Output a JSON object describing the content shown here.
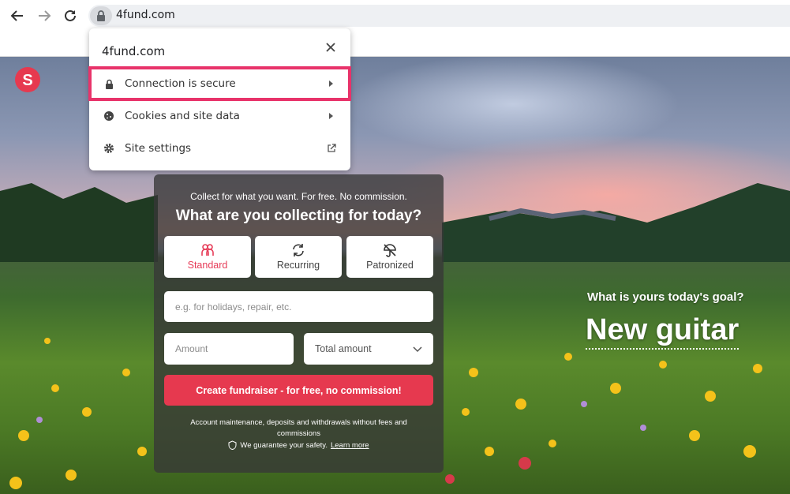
{
  "browser": {
    "url": "4fund.com",
    "icons": {
      "back": "back-arrow-icon",
      "forward": "forward-arrow-icon",
      "reload": "reload-icon",
      "lock": "lock-icon"
    }
  },
  "site_info_popup": {
    "title": "4fund.com",
    "rows": [
      {
        "label": "Connection is secure",
        "icon": "lock-icon",
        "trailing": "arrow-right-icon",
        "highlighted": true
      },
      {
        "label": "Cookies and site data",
        "icon": "cookie-icon",
        "trailing": "arrow-right-icon"
      },
      {
        "label": "Site settings",
        "icon": "gear-icon",
        "trailing": "external-link-icon"
      }
    ]
  },
  "form": {
    "subtitle": "Collect for what you want. For free. No commission.",
    "title": "What are you collecting for today?",
    "types": [
      {
        "label": "Standard",
        "icon": "people-icon",
        "active": true
      },
      {
        "label": "Recurring",
        "icon": "recurring-icon",
        "active": false
      },
      {
        "label": "Patronized",
        "icon": "umbrella-icon",
        "active": false
      }
    ],
    "purpose_placeholder": "e.g. for holidays, repair, etc.",
    "amount_placeholder": "Amount",
    "amount_type_selected": "Total amount",
    "cta_label": "Create fundraiser - for free, no commission!",
    "fine_print": "Account maintenance, deposits and withdrawals without fees and commissions",
    "safety_text": "We guarantee your safety.",
    "learn_more": "Learn more"
  },
  "hero": {
    "question": "What is yours today's goal?",
    "goal": "New guitar"
  },
  "colors": {
    "accent": "#e6394f",
    "highlight": "#e8336a"
  }
}
